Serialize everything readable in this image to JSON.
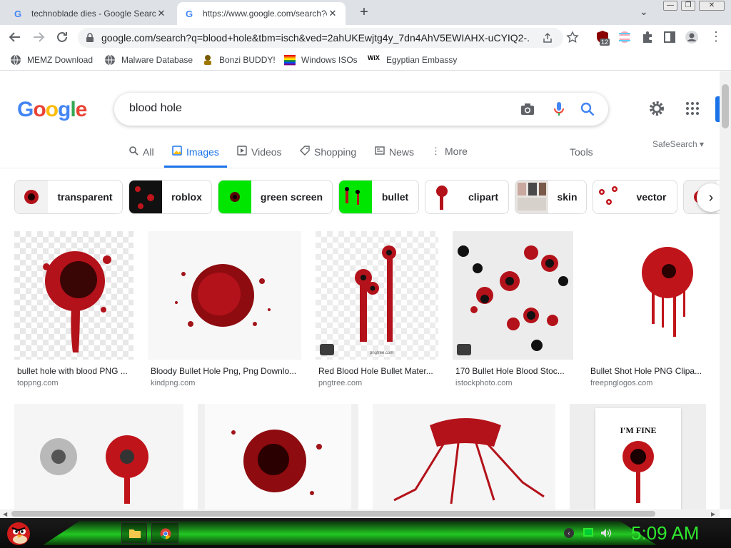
{
  "browser": {
    "tabs": [
      {
        "title": "technoblade dies - Google Search",
        "close": "✕"
      },
      {
        "title": "https://www.google.com/search?q=",
        "close": "✕"
      }
    ],
    "new_tab": "+",
    "tab_menu": "⌄",
    "window_controls": {
      "minimize": "—",
      "restore": "❐",
      "close": "✕"
    },
    "url": "google.com/search?q=blood+hole&tbm=isch&ved=2ahUKEwjtg4y_7dn4AhV5EWIAHX-uCYIQ2-...",
    "extension_badge": "12",
    "bookmarks": [
      {
        "label": "MEMZ Download",
        "icon": "globe-icon"
      },
      {
        "label": "Malware Database",
        "icon": "globe-icon"
      },
      {
        "label": "Bonzi BUDDY!",
        "icon": "bonzi-icon"
      },
      {
        "label": "Windows ISOs",
        "icon": "rainbow-flag-icon"
      },
      {
        "label": "Egyptian Embassy",
        "icon": "wix-icon"
      }
    ],
    "wix_text": "WiX"
  },
  "google": {
    "logo_letters": [
      "G",
      "o",
      "o",
      "g",
      "l",
      "e"
    ],
    "logo_colors": [
      "#4285f4",
      "#ea4335",
      "#fbbc05",
      "#4285f4",
      "#34a853",
      "#ea4335"
    ],
    "query": "blood hole",
    "tabs": [
      {
        "label": "All",
        "icon": "search-icon"
      },
      {
        "label": "Images",
        "icon": "image-icon"
      },
      {
        "label": "Videos",
        "icon": "play-icon"
      },
      {
        "label": "Shopping",
        "icon": "tag-icon"
      },
      {
        "label": "News",
        "icon": "news-icon"
      },
      {
        "label": "More",
        "icon": "more-vert-icon"
      }
    ],
    "tools": "Tools",
    "safesearch": "SafeSearch",
    "chips": [
      "transparent",
      "roblox",
      "green screen",
      "bullet",
      "clipart",
      "skin",
      "vector"
    ],
    "results_row1": [
      {
        "caption": "bullet hole with blood PNG ...",
        "source": "toppng.com"
      },
      {
        "caption": "Bloody Bullet Hole Png, Png Downlo...",
        "source": "kindpng.com"
      },
      {
        "caption": "Red Blood Hole Bullet Mater...",
        "source": "pngtree.com"
      },
      {
        "caption": "170 Bullet Hole Blood Stoc...",
        "source": "istockphoto.com"
      },
      {
        "caption": "Bullet Shot Hole PNG Clipa...",
        "source": "freepnglogos.com"
      }
    ],
    "watermark": "pngtree.com",
    "poster_text": "I'M FINE"
  },
  "taskbar": {
    "clock": "5:09 AM"
  },
  "colors": {
    "accent": "#1a73e8",
    "blood": "#c0141b",
    "clock_green": "#2ee82e"
  }
}
